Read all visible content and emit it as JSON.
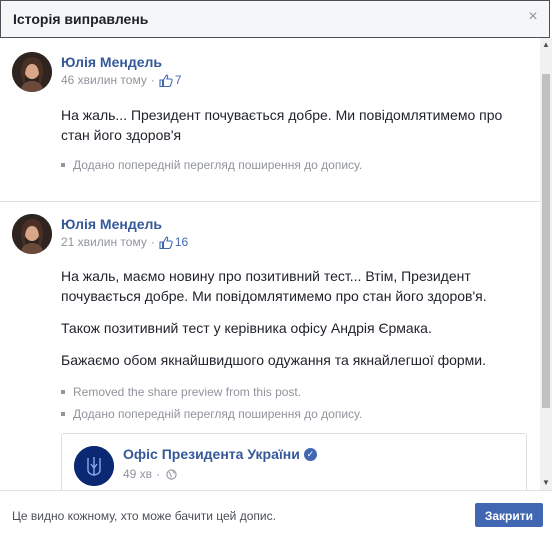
{
  "header": {
    "title": "Історія виправлень",
    "close_glyph": "×"
  },
  "entries": [
    {
      "author": "Юлія Мендель",
      "time": "46 хвилин тому",
      "dot": "·",
      "likes": "7",
      "paragraphs": [
        "На жаль... Президент почувається добре. Ми повідомлятимемо про стан його здоров'я"
      ],
      "changes": [
        "Додано попередній перегляд поширення до допису."
      ]
    },
    {
      "author": "Юлія Мендель",
      "time": "21 хвилин тому",
      "dot": "·",
      "likes": "16",
      "paragraphs": [
        "На жаль, маємо новину про позитивний тест... Втім, Президент почувається добре. Ми повідомлятимемо про стан його здоров'я.",
        "Також позитивний тест у керівника офісу Андрія Єрмака.",
        "Бажаємо обом якнайшвидшого одужання та якнайлегшої форми."
      ],
      "changes": [
        "Removed the share preview from this post.",
        "Додано попередній перегляд поширення до допису."
      ],
      "shared_page": {
        "name": "Офіс Президента України",
        "time": "49 хв",
        "dot": "·",
        "verified_glyph": "✓"
      }
    }
  ],
  "footer": {
    "note": "Це видно кожному, хто може бачити цей допис.",
    "close_label": "Закрити"
  },
  "colors": {
    "link": "#365899",
    "button": "#4267b2",
    "muted": "#90949c"
  },
  "icons": {
    "like": "like-icon",
    "globe": "globe-icon",
    "verified": "verified-icon",
    "close": "close-icon"
  }
}
